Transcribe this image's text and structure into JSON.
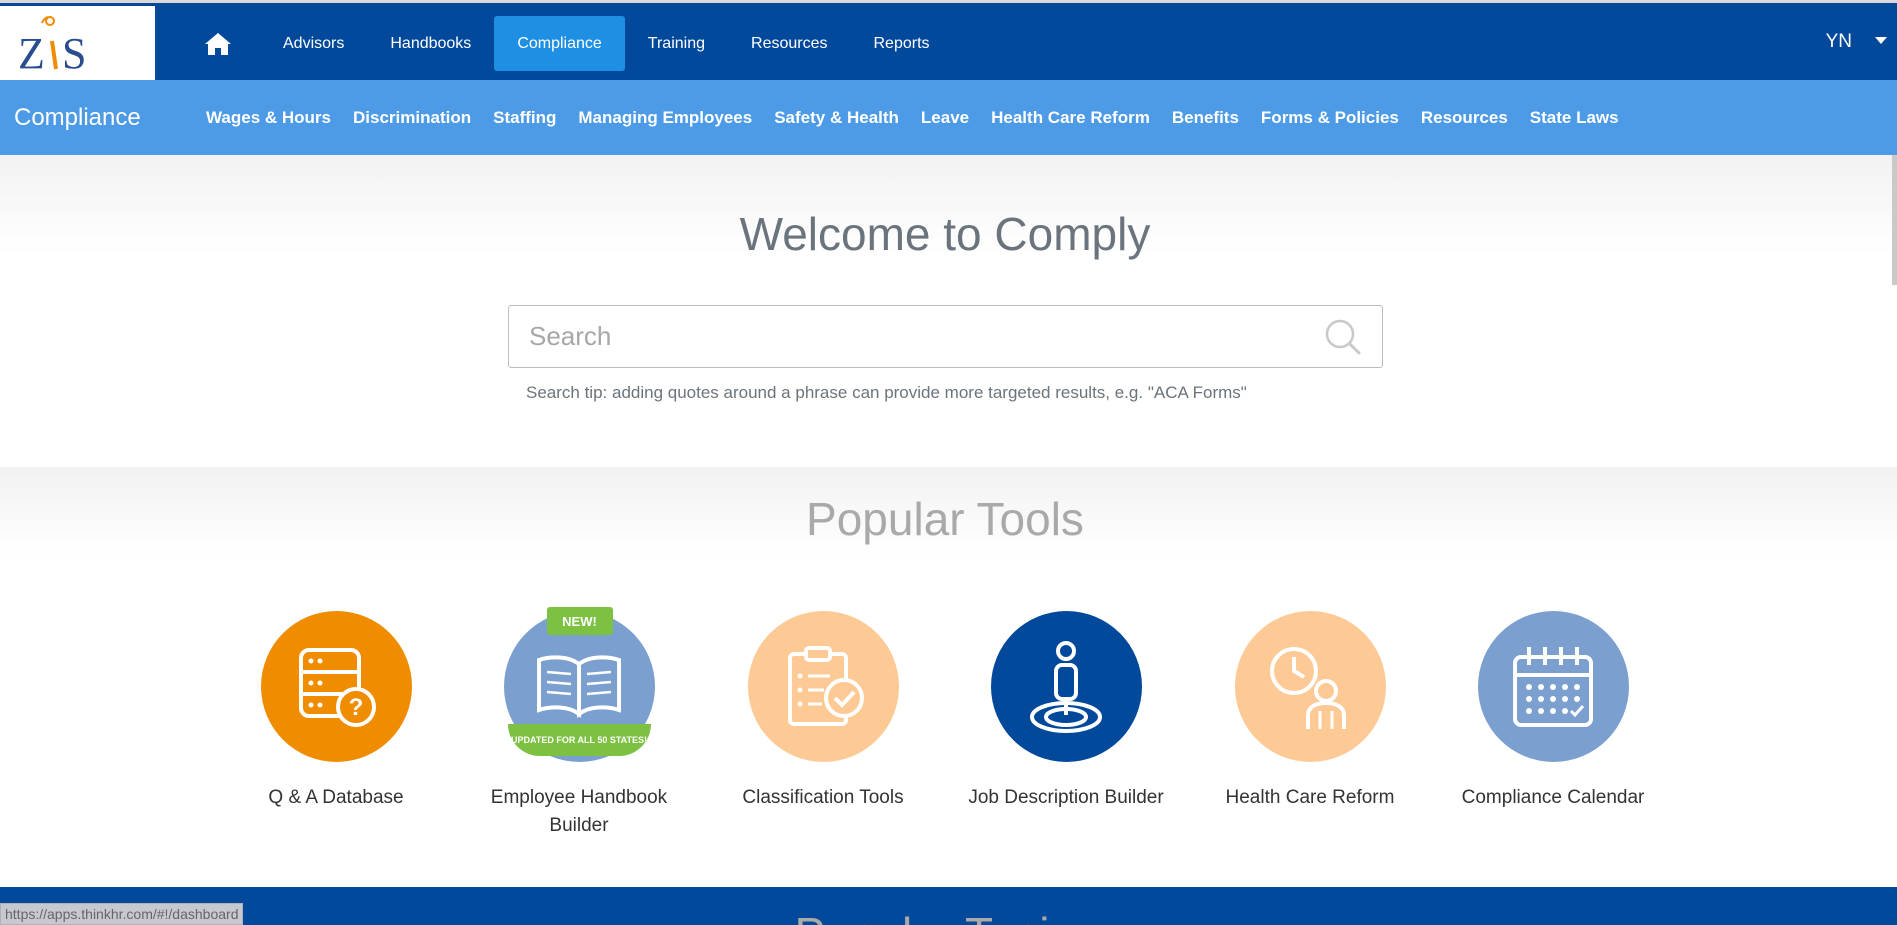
{
  "brand": {
    "logo_text": "ZIS",
    "accent": "#f08c00",
    "primary": "#02499b"
  },
  "topnav": {
    "items": [
      {
        "label": "Advisors"
      },
      {
        "label": "Handbooks"
      },
      {
        "label": "Compliance",
        "active": true
      },
      {
        "label": "Training"
      },
      {
        "label": "Resources"
      },
      {
        "label": "Reports"
      }
    ],
    "user_initials": "YN"
  },
  "subnav": {
    "section_title": "Compliance",
    "items": [
      {
        "label": "Wages & Hours"
      },
      {
        "label": "Discrimination"
      },
      {
        "label": "Staffing"
      },
      {
        "label": "Managing Employees"
      },
      {
        "label": "Safety & Health"
      },
      {
        "label": "Leave"
      },
      {
        "label": "Health Care Reform"
      },
      {
        "label": "Benefits"
      },
      {
        "label": "Forms & Policies"
      },
      {
        "label": "Resources"
      },
      {
        "label": "State Laws"
      }
    ]
  },
  "hero": {
    "title": "Welcome to Comply",
    "search_placeholder": "Search",
    "search_tip": "Search tip: adding quotes around a phrase can provide more targeted results, e.g. \"ACA Forms\""
  },
  "tools": {
    "title": "Popular Tools",
    "items": [
      {
        "label": "Q & A Database",
        "icon": "database-question-icon",
        "color": "#f08c00"
      },
      {
        "label": "Employee Handbook Builder",
        "icon": "open-book-icon",
        "color": "#7b9fcf",
        "badge_top": "NEW!",
        "badge_bottom": "UPDATED FOR ALL 50 STATES!"
      },
      {
        "label": "Classification Tools",
        "icon": "clipboard-check-icon",
        "color": "#fdca96"
      },
      {
        "label": "Job Description Builder",
        "icon": "person-target-icon",
        "color": "#02499b"
      },
      {
        "label": "Health Care Reform",
        "icon": "clock-person-icon",
        "color": "#fdca96"
      },
      {
        "label": "Compliance Calendar",
        "icon": "calendar-icon",
        "color": "#7b9fcf"
      }
    ]
  },
  "footer": {
    "title": "Popular Topics"
  },
  "status_url": "https://apps.thinkhr.com/#!/dashboard"
}
